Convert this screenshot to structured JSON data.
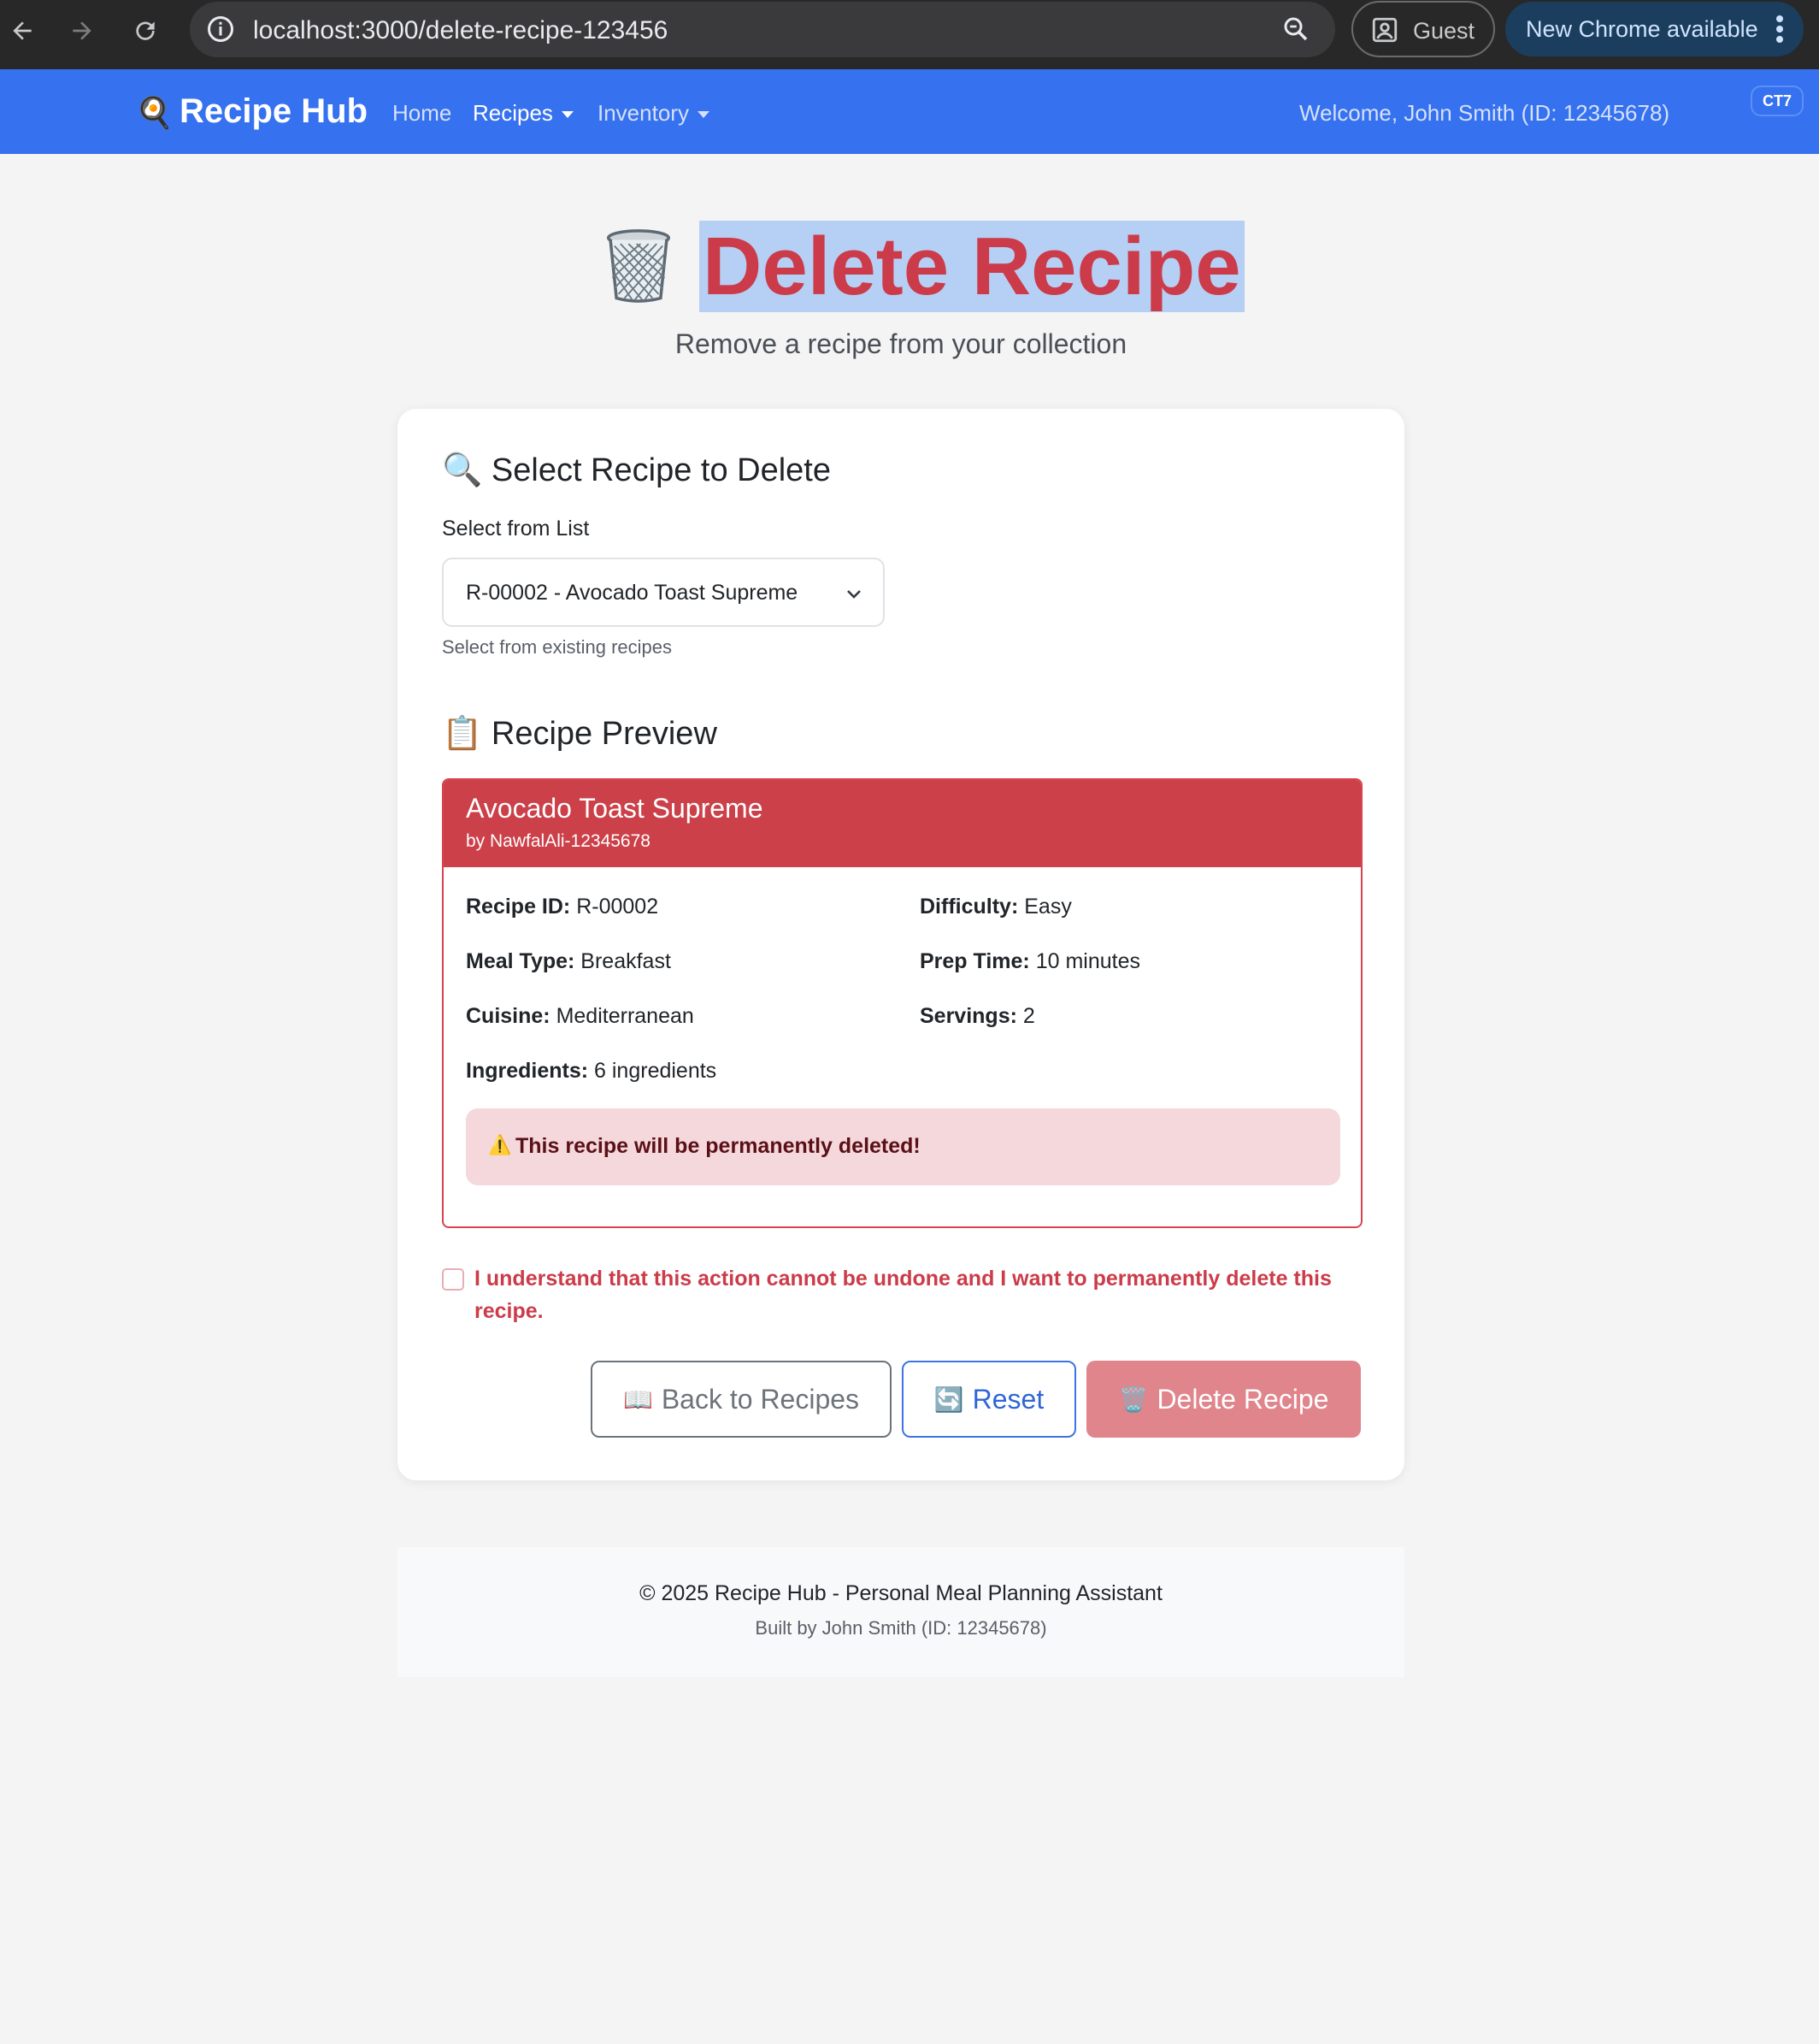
{
  "browser": {
    "url": "localhost:3000/delete-recipe-123456",
    "guest_label": "Guest",
    "update_label": "New Chrome available",
    "icons": [
      "back-arrow-icon",
      "forward-arrow-icon",
      "reload-icon",
      "site-info-icon",
      "zoom-icon",
      "profile-icon",
      "more-vert-icon"
    ]
  },
  "navbar": {
    "brand": "Recipe Hub",
    "brand_icon": "🍳",
    "links": {
      "home": "Home",
      "recipes": "Recipes",
      "inventory": "Inventory"
    },
    "welcome": "Welcome, John Smith (ID: 12345678)",
    "badge": "CT7",
    "accent_color": "#3671ef"
  },
  "header": {
    "title": "Delete Recipe",
    "subtitle": "Remove a recipe from your collection",
    "title_color": "#cc3b49"
  },
  "select_section": {
    "heading_icon": "🔍",
    "heading": "Select Recipe to Delete",
    "label": "Select from List",
    "selected_value": "R-00002 - Avocado Toast Supreme",
    "help_text": "Select from existing recipes"
  },
  "preview": {
    "heading_icon": "📋",
    "heading": "Recipe Preview",
    "name": "Avocado Toast Supreme",
    "author": "by NawfalAli-12345678",
    "fields": {
      "recipe_id_label": "Recipe ID:",
      "recipe_id": "R-00002",
      "difficulty_label": "Difficulty:",
      "difficulty": "Easy",
      "meal_type_label": "Meal Type:",
      "meal_type": "Breakfast",
      "prep_time_label": "Prep Time:",
      "prep_time": "10 minutes",
      "cuisine_label": "Cuisine:",
      "cuisine": "Mediterranean",
      "servings_label": "Servings:",
      "servings": "2",
      "ingredients_label": "Ingredients:",
      "ingredients": "6 ingredients"
    },
    "warning_icon": "⚠️",
    "warning": "This recipe will be permanently deleted!",
    "header_color": "#cc4049"
  },
  "confirm": {
    "label": "I understand that this action cannot be undone and I want to permanently delete this recipe.",
    "checked": false
  },
  "buttons": {
    "back_icon": "📖",
    "back": "Back to Recipes",
    "reset_icon": "🔄",
    "reset": "Reset",
    "delete_icon": "🗑️",
    "delete": "Delete Recipe"
  },
  "footer": {
    "line1": "© 2025 Recipe Hub - Personal Meal Planning Assistant",
    "line2": "Built by John Smith (ID: 12345678)"
  }
}
